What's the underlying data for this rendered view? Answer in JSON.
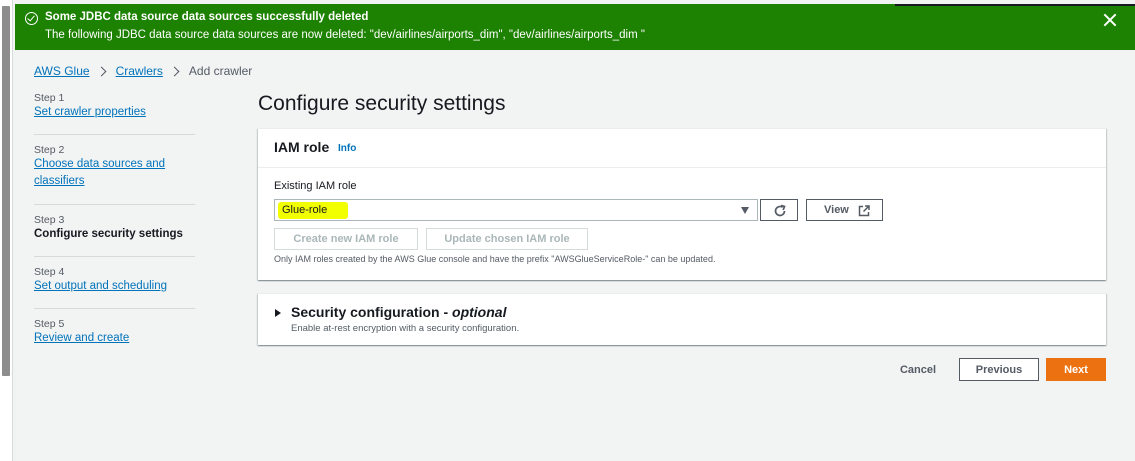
{
  "flash": {
    "title": "Some JDBC data source data sources successfully deleted",
    "message": "The following JDBC data source data sources are now deleted: \"dev/airlines/airports_dim\", \"dev/airlines/airports_dim \"",
    "color": "#1d8102"
  },
  "breadcrumb": {
    "items": [
      "AWS Glue",
      "Crawlers"
    ],
    "current": "Add crawler"
  },
  "steps": [
    {
      "num": "Step 1",
      "label": "Set crawler properties"
    },
    {
      "num": "Step 2",
      "label": "Choose data sources and classifiers"
    },
    {
      "num": "Step 3",
      "label": "Configure security settings"
    },
    {
      "num": "Step 4",
      "label": "Set output and scheduling"
    },
    {
      "num": "Step 5",
      "label": "Review and create"
    }
  ],
  "page_title": "Configure security settings",
  "iam": {
    "title": "IAM role",
    "info": "Info",
    "field_label": "Existing IAM role",
    "selected_role": "Glue-role",
    "view_label": "View",
    "create_label": "Create new IAM role",
    "update_label": "Update chosen IAM role",
    "help": "Only IAM roles created by the AWS Glue console and have the prefix \"AWSGlueServiceRole-\" can be updated."
  },
  "security": {
    "title": "Security configuration",
    "optional": "optional",
    "description": "Enable at-rest encryption with a security configuration."
  },
  "actions": {
    "cancel": "Cancel",
    "previous": "Previous",
    "next": "Next"
  },
  "colors": {
    "primary": "#ec7211",
    "link": "#0073bb",
    "highlight": "#f2ff00"
  }
}
